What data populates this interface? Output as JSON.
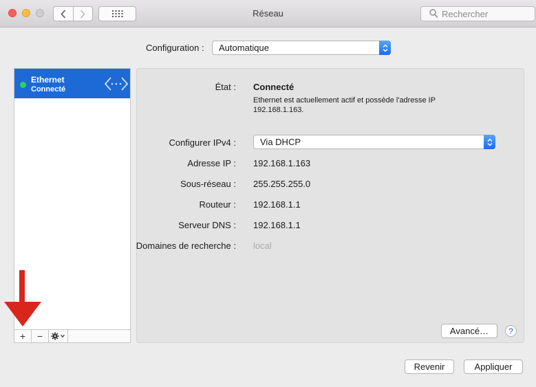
{
  "window": {
    "title": "Réseau",
    "search_placeholder": "Rechercher"
  },
  "config": {
    "label": "Configuration :",
    "value": "Automatique"
  },
  "sidebar": {
    "services": [
      {
        "name": "Ethernet",
        "status": "Connecté",
        "status_color": "#30d158"
      }
    ],
    "bottom_bar": {
      "add": "+",
      "remove": "−"
    }
  },
  "detail": {
    "state_label": "État :",
    "state_value": "Connecté",
    "description_line1": "Ethernet est actuellement actif et possède l'adresse IP",
    "description_line2": "192.168.1.163.",
    "ipv4_label": "Configurer IPv4 :",
    "ipv4_value": "Via DHCP",
    "ip_label": "Adresse IP :",
    "ip_value": "192.168.1.163",
    "subnet_label": "Sous-réseau :",
    "subnet_value": "255.255.255.0",
    "router_label": "Routeur :",
    "router_value": "192.168.1.1",
    "dns_label": "Serveur DNS :",
    "dns_value": "192.168.1.1",
    "domains_label": "Domaines de recherche :",
    "domains_value": "local",
    "advanced_button": "Avancé…",
    "help_button": "?"
  },
  "footer": {
    "revert_button": "Revenir",
    "apply_button": "Appliquer"
  },
  "colors": {
    "accent": "#1d6ad7",
    "annotation_arrow": "#d9261c"
  }
}
